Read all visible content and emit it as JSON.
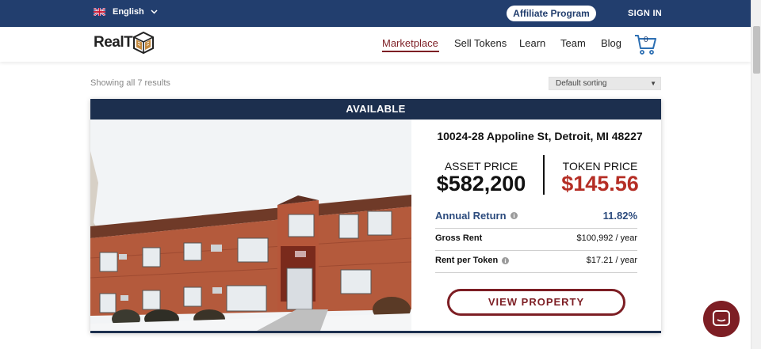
{
  "topbar": {
    "language": "English",
    "affiliate_label": "Affiliate Program",
    "signin_label": "SIGN IN"
  },
  "logo": {
    "text": "RealT"
  },
  "nav": {
    "items": [
      "Marketplace",
      "Sell Tokens",
      "Learn",
      "Team",
      "Blog"
    ],
    "active": "Marketplace",
    "cart_count": "0"
  },
  "results": {
    "summary": "Showing all 7 results",
    "sort_selected": "Default sorting"
  },
  "listing": {
    "status": "AVAILABLE",
    "address": "10024-28 Appoline St, Detroit, MI 48227",
    "asset_price_label": "ASSET PRICE",
    "asset_price": "$582,200",
    "token_price_label": "TOKEN PRICE",
    "token_price": "$145.56",
    "annual_return_label": "Annual Return",
    "annual_return": "11.82%",
    "gross_rent_label": "Gross Rent",
    "gross_rent": "$100,992 / year",
    "rent_per_token_label": "Rent per Token",
    "rent_per_token": "$17.21 / year",
    "view_label": "VIEW PROPERTY"
  },
  "colors": {
    "navy": "#223e6e",
    "band": "#1c2f4e",
    "maroon": "#7d1e24",
    "token_red": "#b52e25",
    "return_blue": "#2c4b7d"
  }
}
